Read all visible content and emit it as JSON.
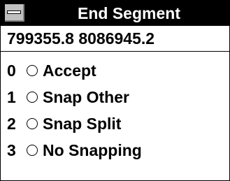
{
  "window": {
    "title": "End Segment",
    "coordinates": "799355.8  8086945.2"
  },
  "options": [
    {
      "key": "0",
      "label": "Accept",
      "selected": false
    },
    {
      "key": "1",
      "label": "Snap Other",
      "selected": false
    },
    {
      "key": "2",
      "label": "Snap Split",
      "selected": false
    },
    {
      "key": "3",
      "label": "No Snapping",
      "selected": false
    }
  ],
  "icons": {
    "system_menu": "system-menu-icon",
    "radio": "radio-button-icon"
  },
  "colors": {
    "titlebar_bg": "#000000",
    "titlebar_text": "#ffffff",
    "window_bg": "#ffffff"
  }
}
